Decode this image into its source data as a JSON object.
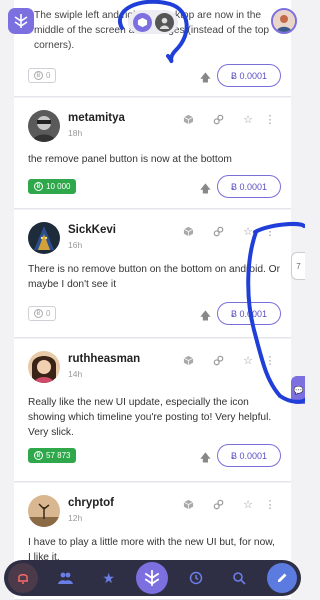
{
  "top": {
    "snippet": "The swiple left and right on desktop are now in the middle of the screen at the edges (instead of the top corners)."
  },
  "posts": [
    {
      "username": "metamitya",
      "time": "18h",
      "text": "the remove panel button is now at the bottom",
      "tip": "10 000",
      "amount": "Ƀ 0.0001"
    },
    {
      "username": "SickKevi",
      "time": "16h",
      "text": "There is no remove button on the bottom on android. Or maybe I don't see it",
      "tip": "0",
      "amount": "Ƀ 0.0001"
    },
    {
      "username": "ruthheasman",
      "time": "14h",
      "text": "Really like the new UI update, especially the icon showing which timeline you're posting to! Very helpful. Very slick.",
      "tip": "57 873",
      "amount": "Ƀ 0.0001"
    },
    {
      "username": "chryptof",
      "time": "12h",
      "text": "I have to play a little more with the new UI but, for now, I like it.\nLike the timeline icons. Like that all \"public\" timelines (Twetch,"
    }
  ],
  "first_card": {
    "tip": "0",
    "amount": "Ƀ 0.0001"
  },
  "side": {
    "count": "7"
  },
  "colors": {
    "accent": "#7c6fe0",
    "annotation": "#1f3fd8",
    "tip_green": "#2ea84a",
    "bar": "#2e2f45"
  }
}
